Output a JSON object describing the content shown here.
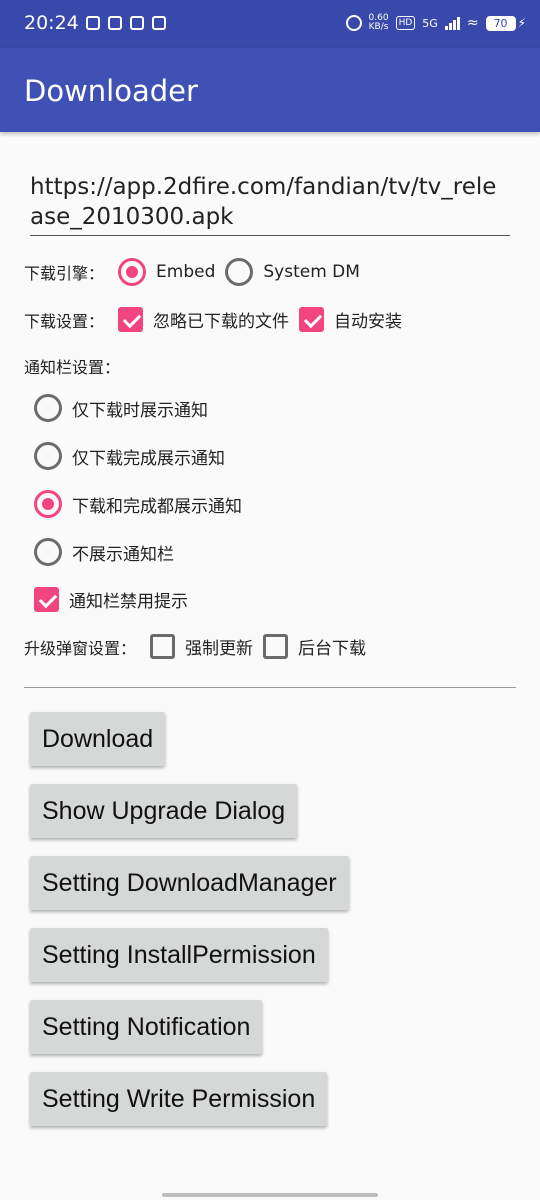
{
  "status_bar": {
    "time": "20:24",
    "speed_top": "0.60",
    "speed_bottom": "KB/s",
    "hd": "HD",
    "network": "5G",
    "battery": "70"
  },
  "app_bar": {
    "title": "Downloader"
  },
  "url_input": {
    "value": "https://app.2dfire.com/fandian/tv/tv_release_2010300.apk"
  },
  "engine": {
    "label": "下载引擎：",
    "options": [
      {
        "label": "Embed",
        "checked": true
      },
      {
        "label": "System DM",
        "checked": false
      }
    ]
  },
  "download_settings": {
    "label": "下载设置：",
    "options": [
      {
        "label": "忽略已下载的文件",
        "checked": true
      },
      {
        "label": "自动安装",
        "checked": true
      }
    ]
  },
  "notification_settings": {
    "label": "通知栏设置：",
    "options": [
      {
        "label": "仅下载时展示通知",
        "checked": false
      },
      {
        "label": "仅下载完成展示通知",
        "checked": false
      },
      {
        "label": "下载和完成都展示通知",
        "checked": true
      },
      {
        "label": "不展示通知栏",
        "checked": false
      }
    ],
    "disable_hint": {
      "label": "通知栏禁用提示",
      "checked": true
    }
  },
  "upgrade_dialog_settings": {
    "label": "升级弹窗设置：",
    "options": [
      {
        "label": "强制更新",
        "checked": false
      },
      {
        "label": "后台下载",
        "checked": false
      }
    ]
  },
  "buttons": [
    "Download",
    "Show Upgrade Dialog",
    "Setting DownloadManager",
    "Setting InstallPermission",
    "Setting Notification",
    "Setting Write Permission"
  ],
  "colors": {
    "status_bar": "#3949ab",
    "app_bar": "#3f51b5",
    "accent": "#f2457f"
  }
}
